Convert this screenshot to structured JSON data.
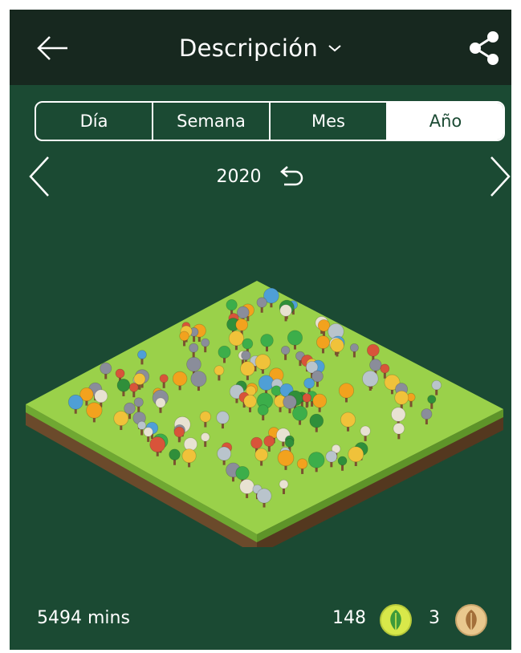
{
  "header": {
    "title": "Descripción"
  },
  "tabs": [
    {
      "label": "Día",
      "active": false
    },
    {
      "label": "Semana",
      "active": false
    },
    {
      "label": "Mes",
      "active": false
    },
    {
      "label": "Año",
      "active": true
    }
  ],
  "period": {
    "year": "2020"
  },
  "stats": {
    "minutes": "5494 mins",
    "healthy_trees": "148",
    "dead_trees": "3"
  },
  "colors": {
    "header_bg": "#17281f",
    "page_bg": "#1b4a33",
    "grass": "#8cc63f",
    "soil": "#6b4a2b",
    "healthy_icon": "#d8e84a",
    "dead_icon": "#e9c88e"
  },
  "icons": {
    "back": "arrow-left-icon",
    "dropdown": "chevron-down-icon",
    "share": "share-icon",
    "prev": "chevron-left-icon",
    "next": "chevron-right-icon",
    "reset": "undo-icon",
    "healthy": "leaf-icon",
    "dead": "withered-leaf-icon"
  }
}
